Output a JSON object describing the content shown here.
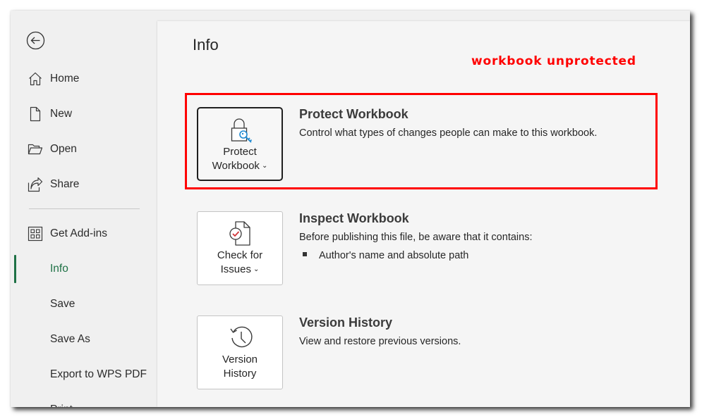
{
  "sidebar": {
    "back_label": "Back",
    "items": [
      {
        "label": "Home",
        "icon": "home-icon"
      },
      {
        "label": "New",
        "icon": "new-document-icon"
      },
      {
        "label": "Open",
        "icon": "open-folder-icon"
      },
      {
        "label": "Share",
        "icon": "share-icon"
      },
      {
        "label": "Get Add-ins",
        "icon": "add-ins-grid-icon"
      },
      {
        "label": "Info",
        "active": true
      },
      {
        "label": "Save"
      },
      {
        "label": "Save As"
      },
      {
        "label": "Export to WPS PDF"
      },
      {
        "label": "Print"
      }
    ],
    "active_color": "#1e7145"
  },
  "main": {
    "title": "Info",
    "annotation": "workbook unprotected",
    "annotation_color": "#ff0000",
    "sections": [
      {
        "button_line1": "Protect",
        "button_line2": "Workbook",
        "button_has_dropdown": true,
        "icon": "lock-key-icon",
        "title": "Protect Workbook",
        "description": "Control what types of changes people can make to this workbook.",
        "highlighted": true
      },
      {
        "button_line1": "Check for",
        "button_line2": "Issues",
        "button_has_dropdown": true,
        "icon": "document-check-icon",
        "title": "Inspect Workbook",
        "description": "Before publishing this file, be aware that it contains:",
        "bullets": [
          "Author's name and absolute path"
        ]
      },
      {
        "button_line1": "Version",
        "button_line2": "History",
        "button_has_dropdown": false,
        "icon": "history-clock-icon",
        "title": "Version History",
        "description": "View and restore previous versions."
      }
    ],
    "dropdown_glyph": "⌄"
  }
}
